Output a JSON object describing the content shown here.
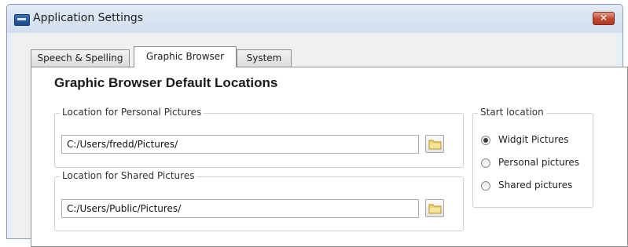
{
  "window": {
    "title": "Application Settings",
    "close_glyph": "✕"
  },
  "tabs": [
    {
      "label": "Speech & Spelling",
      "active": false
    },
    {
      "label": "Graphic Browser",
      "active": true
    },
    {
      "label": "System",
      "active": false
    }
  ],
  "panel": {
    "title": "Graphic Browser Default Locations",
    "personal": {
      "legend": "Location for Personal Pictures",
      "value": "C:/Users/fredd/Pictures/",
      "browse_icon": "folder-icon"
    },
    "shared": {
      "legend": "Location for Shared Pictures",
      "value": "C:/Users/Public/Pictures/",
      "browse_icon": "folder-icon"
    },
    "start_location": {
      "legend": "Start location",
      "options": [
        {
          "label": "Widgit Pictures",
          "checked": true
        },
        {
          "label": "Personal pictures",
          "checked": false
        },
        {
          "label": "Shared pictures",
          "checked": false
        }
      ]
    }
  },
  "colors": {
    "close_button": "#c0482f",
    "folder": "#f2d36b"
  }
}
